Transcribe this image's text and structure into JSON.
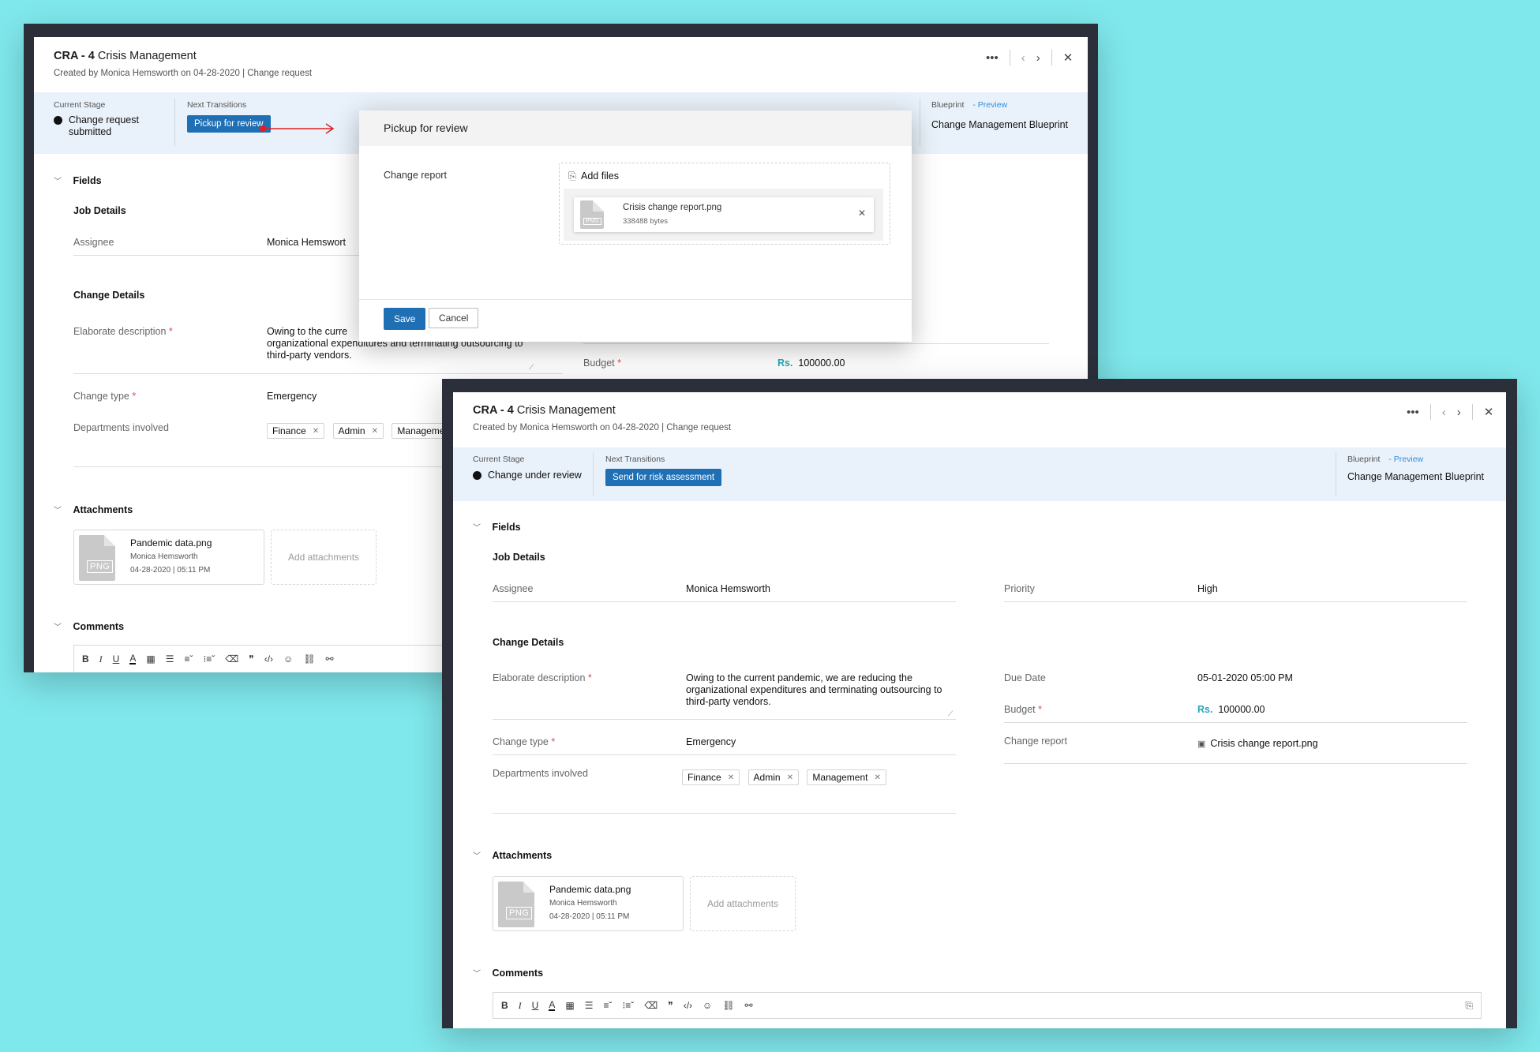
{
  "left_window": {
    "id_label": "CRA - 4",
    "title": "Crisis Management",
    "subtitle": "Created by  Monica Hemsworth  on 04-28-2020 | Change request",
    "current_stage_label": "Current Stage",
    "current_stage_line1": "Change request",
    "current_stage_line2": "submitted",
    "next_transitions_label": "Next Transitions",
    "transition_button": "Pickup for review",
    "blueprint_label": "Blueprint",
    "preview_link": "- Preview",
    "blueprint_name": "Change Management Blueprint",
    "fields_header": "Fields",
    "job_details": "Job Details",
    "assignee_label": "Assignee",
    "assignee_value": "Monica Hemswort",
    "change_details": "Change Details",
    "elaborate_label": "Elaborate description",
    "elaborate_line1": "Owing to the curre",
    "elaborate_line2": "organizational expenditures and terminating outsourcing to",
    "elaborate_line3": "third-party vendors.",
    "budget_label": "Budget",
    "budget_currency": "Rs.",
    "budget_value": "100000.00",
    "change_type_label": "Change type",
    "change_type_value": "Emergency",
    "departments_label": "Departments involved",
    "departments": [
      "Finance",
      "Admin",
      "Managemen"
    ],
    "attachments_header": "Attachments",
    "attachment": {
      "name": "Pandemic data.png",
      "owner": "Monica Hemsworth",
      "date": "04-28-2020 | 05:11 PM",
      "type": "PNG"
    },
    "add_attachments": "Add attachments",
    "comments_header": "Comments"
  },
  "modal": {
    "title": "Pickup for review",
    "field_label": "Change report",
    "add_files": "Add files",
    "file_name": "Crisis change report.png",
    "file_size": "338488 bytes",
    "file_type": "PNG",
    "save": "Save",
    "cancel": "Cancel"
  },
  "right_window": {
    "id_label": "CRA - 4",
    "title": "Crisis Management",
    "subtitle": "Created by  Monica Hemsworth  on 04-28-2020 | Change request",
    "current_stage_label": "Current Stage",
    "current_stage": "Change under review",
    "next_transitions_label": "Next Transitions",
    "transition_button": "Send for risk assessment",
    "blueprint_label": "Blueprint",
    "preview_link": "- Preview",
    "blueprint_name": "Change Management Blueprint",
    "fields_header": "Fields",
    "job_details": "Job Details",
    "assignee_label": "Assignee",
    "assignee_value": "Monica Hemsworth",
    "priority_label": "Priority",
    "priority_value": "High",
    "change_details": "Change Details",
    "elaborate_label": "Elaborate description",
    "elaborate_line1": "Owing to the current pandemic, we are reducing the",
    "elaborate_line2": "organizational expenditures and terminating outsourcing to",
    "elaborate_line3": "third-party vendors.",
    "due_date_label": "Due Date",
    "due_date_value": "05-01-2020 05:00 PM",
    "budget_label": "Budget",
    "budget_currency": "Rs.",
    "budget_value": "100000.00",
    "change_type_label": "Change type",
    "change_type_value": "Emergency",
    "change_report_label": "Change report",
    "change_report_value": "Crisis change report.png",
    "departments_label": "Departments involved",
    "departments": [
      "Finance",
      "Admin",
      "Management"
    ],
    "attachments_header": "Attachments",
    "attachment": {
      "name": "Pandemic data.png",
      "owner": "Monica Hemsworth",
      "date": "04-28-2020 | 05:11 PM",
      "type": "PNG"
    },
    "add_attachments": "Add attachments",
    "comments_header": "Comments"
  },
  "icons": {
    "more": "more-icon",
    "prev": "chevron-left-icon",
    "next": "chevron-right-icon",
    "close": "close-icon"
  },
  "colors": {
    "background": "#7fe8ec",
    "window_frame": "#2b2f3a",
    "stage_bar": "#e9f1fa",
    "primary_button": "#1f6fb5",
    "link": "#2f8ee0",
    "arrow": "#e02020"
  }
}
